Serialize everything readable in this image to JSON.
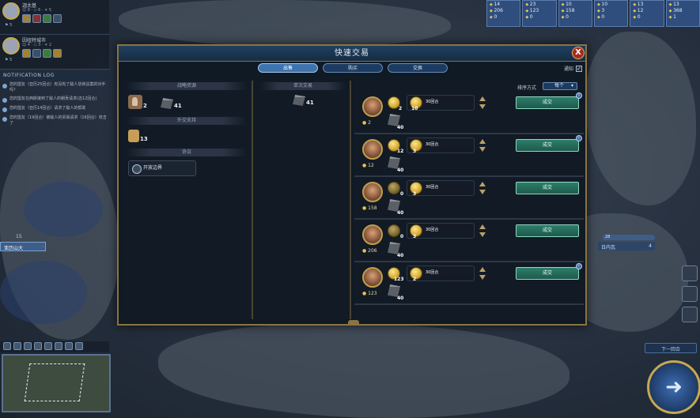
{
  "civs": [
    {
      "name": "迦太基",
      "stat": "☺ 8 · ◇ 6 · ✦ 5",
      "mini": "⚑ 5"
    },
    {
      "name": "因纽特城市",
      "stat": "☺ 4 · ◇ 3 · ✦ 2",
      "mini": "⚑ 5"
    }
  ],
  "notifications": {
    "header": "NOTIFICATION LOG",
    "items": [
      "您的盟友（亚历25回合）有没有了敌人协商议案的对手吗？",
      "您的盟友在西斯接到了敌人的朝贡请求(还12回合)",
      "您的盟友（亚历14回合）请求了敌人的帮助",
      "您的盟友（19回合）被敌人的贸易请求（16回合）攻击了"
    ]
  },
  "map": {
    "city_name": "亚历山大",
    "city_pop": "15",
    "right_city": {
      "strength": "28",
      "name": "日内瓦",
      "pop": "4"
    }
  },
  "resources": [
    [
      "14",
      "206",
      "0"
    ],
    [
      "23",
      "123",
      "0"
    ],
    [
      "10",
      "158",
      "0"
    ],
    [
      "10",
      "3",
      "0"
    ],
    [
      "13",
      "12",
      "0"
    ],
    [
      "13",
      "368",
      "1"
    ]
  ],
  "next_turn": {
    "label": "下一回合",
    "glyph": "➜"
  },
  "dialog": {
    "title": "快速交易",
    "close": "X",
    "tabs": [
      "出售",
      "购买",
      "交换"
    ],
    "notify_label": "通知",
    "notify_check": "✓",
    "left": {
      "strategic_header": "战略资源",
      "horse_count": "2",
      "iron_count": "41",
      "diplomacy_header": "外交支持",
      "wine_count": "13",
      "agreements_header": "协议",
      "agreement": "开放边界"
    },
    "middle": {
      "header": "单次交易",
      "iron_count": "41"
    },
    "right": {
      "sort_label": "排序方式",
      "sort_value": "每个",
      "offers": [
        {
          "leader_gold": "2",
          "gold_lump": "2",
          "gpt": "10",
          "gpt_label": "30回合",
          "iron": "40",
          "deal": "成交",
          "info": "i",
          "has_info": true,
          "dark": false
        },
        {
          "leader_gold": "12",
          "gold_lump": "12",
          "gpt": "3",
          "gpt_label": "30回合",
          "iron": "40",
          "deal": "成交",
          "info": "i",
          "has_info": true,
          "dark": false
        },
        {
          "leader_gold": "158",
          "gold_lump": "0",
          "gpt": "3",
          "gpt_label": "30回合",
          "iron": "40",
          "deal": "成交",
          "info": "",
          "has_info": false,
          "dark": true
        },
        {
          "leader_gold": "206",
          "gold_lump": "0",
          "gpt": "3",
          "gpt_label": "30回合",
          "iron": "40",
          "deal": "成交",
          "info": "",
          "has_info": false,
          "dark": true
        },
        {
          "leader_gold": "123",
          "gold_lump": "123",
          "gpt": "2",
          "gpt_label": "30回合",
          "iron": "40",
          "deal": "成交",
          "info": "i",
          "has_info": true,
          "dark": false
        }
      ]
    }
  }
}
